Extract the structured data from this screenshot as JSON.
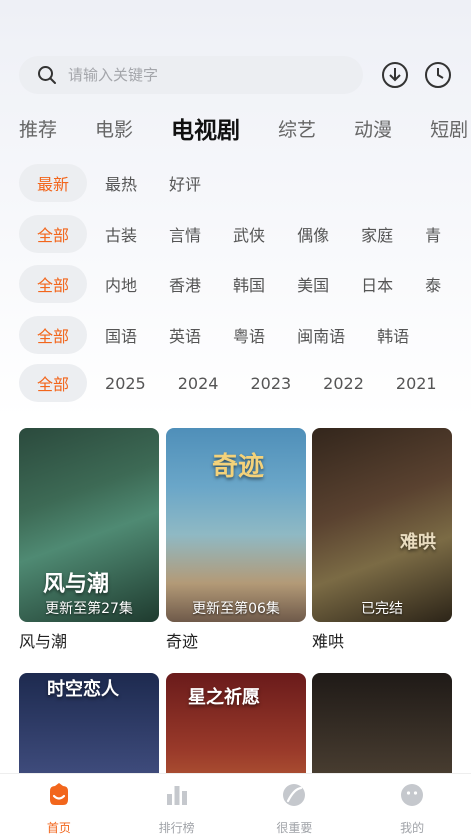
{
  "search": {
    "placeholder": "请输入关键字"
  },
  "header_icons": {
    "download": "download-icon",
    "history": "history-icon"
  },
  "tabs": [
    "推荐",
    "电影",
    "电视剧",
    "综艺",
    "动漫",
    "短剧"
  ],
  "active_tab": "电视剧",
  "filters": {
    "sort": [
      "最新",
      "最热",
      "好评"
    ],
    "genre": [
      "全部",
      "古装",
      "言情",
      "武侠",
      "偶像",
      "家庭",
      "青"
    ],
    "region": [
      "全部",
      "内地",
      "香港",
      "韩国",
      "美国",
      "日本",
      "泰"
    ],
    "language": [
      "全部",
      "国语",
      "英语",
      "粤语",
      "闽南语",
      "韩语"
    ],
    "year": [
      "全部",
      "2025",
      "2024",
      "2023",
      "2022",
      "2021"
    ]
  },
  "shows": [
    {
      "title": "风与潮",
      "badge": "更新至第27集",
      "poster_text": "风与潮"
    },
    {
      "title": "奇迹",
      "badge": "更新至第06集",
      "poster_text": "奇迹"
    },
    {
      "title": "难哄",
      "badge": "已完结",
      "poster_text": "难哄"
    },
    {
      "title": "",
      "badge": "",
      "poster_text": "时空恋人"
    },
    {
      "title": "",
      "badge": "",
      "poster_text": "星之祈愿"
    },
    {
      "title": "",
      "badge": "",
      "poster_text": ""
    }
  ],
  "bottom_nav": [
    {
      "label": "首页",
      "icon": "home-icon"
    },
    {
      "label": "排行榜",
      "icon": "bar-chart-icon"
    },
    {
      "label": "很重要",
      "icon": "leaf-icon"
    },
    {
      "label": "我的",
      "icon": "smiley-face-icon"
    }
  ],
  "colors": {
    "accent": "#f2661c",
    "chip_bg": "#eceef1"
  }
}
